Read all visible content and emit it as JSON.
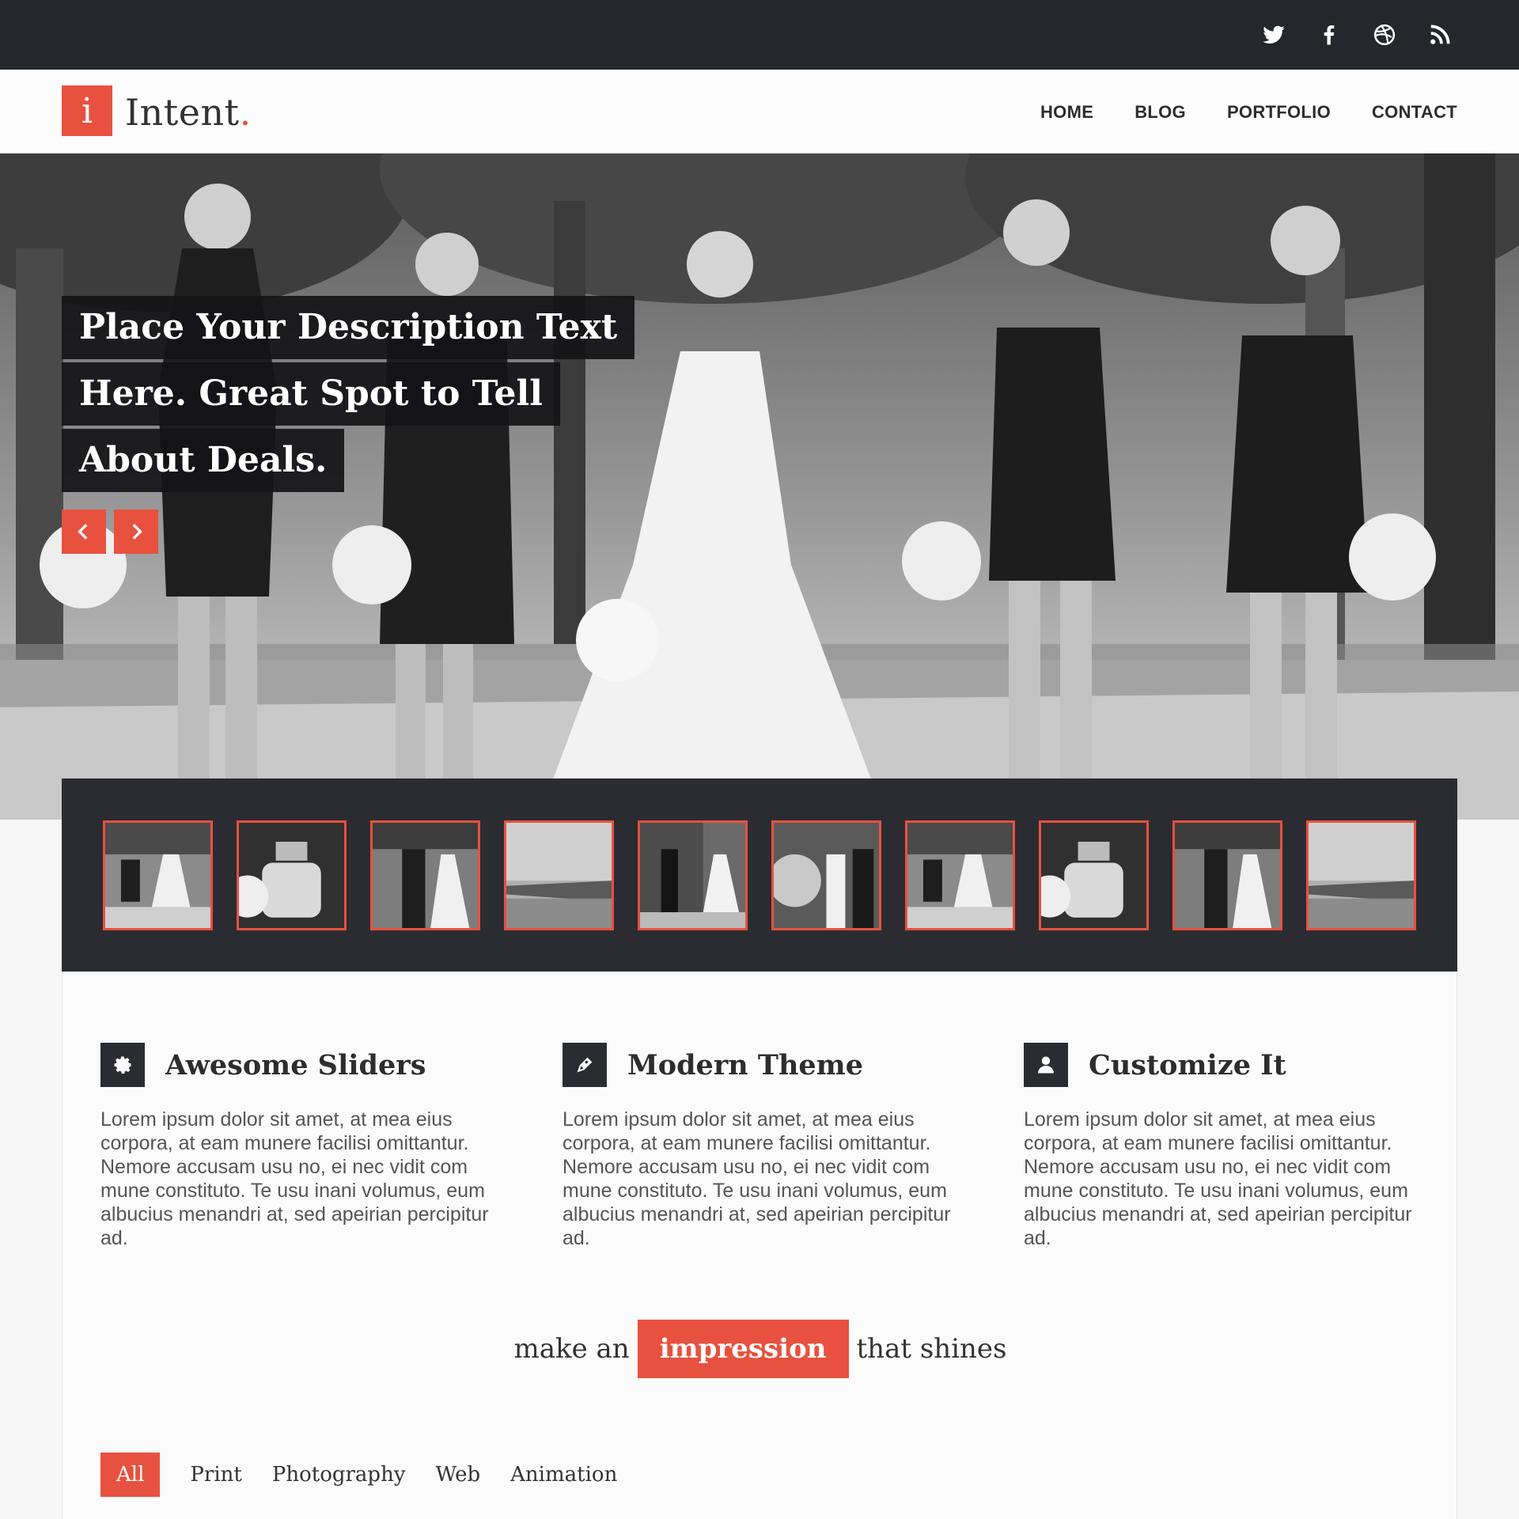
{
  "colors": {
    "accent": "#e8513f",
    "dark": "#24272c",
    "strip": "#2a2c31"
  },
  "social": {
    "icons": [
      "twitter-icon",
      "facebook-icon",
      "dribbble-icon",
      "rss-icon"
    ]
  },
  "header": {
    "logo_letter": "i",
    "logo_text": "Intent",
    "logo_dot": ".",
    "nav": [
      "HOME",
      "BLOG",
      "PORTFOLIO",
      "CONTACT"
    ]
  },
  "hero": {
    "caption_lines": [
      "Place Your Description Text",
      "Here. Great Spot to Tell",
      "About Deals."
    ],
    "prev_icon": "chevron-left-icon",
    "next_icon": "chevron-right-icon"
  },
  "thumbnails": {
    "count": 10,
    "subjects": [
      "bridal-party",
      "perfume-bottle",
      "couple-walking",
      "bridge",
      "couple-wall",
      "group",
      "bridal-party",
      "perfume-bottle",
      "couple-walking",
      "bridge"
    ]
  },
  "features": [
    {
      "icon": "gear-icon",
      "title": "Awesome Sliders",
      "text": "Lorem ipsum dolor sit amet, at mea eius corpora, at eam munere facilisi omittantur. Nemore accusam usu no, ei nec vidit com mune constituto. Te usu inani volumus, eum albucius menandri at, sed apeirian percipitur ad."
    },
    {
      "icon": "pen-icon",
      "title": "Modern Theme",
      "text": "Lorem ipsum dolor sit amet, at mea eius corpora, at eam munere facilisi omittantur. Nemore accusam usu no, ei nec vidit com mune constituto. Te usu inani volumus, eum albucius menandri at, sed apeirian percipitur ad."
    },
    {
      "icon": "user-icon",
      "title": "Customize It",
      "text": "Lorem ipsum dolor sit amet, at mea eius corpora, at eam munere facilisi omittantur. Nemore accusam usu no, ei nec vidit com mune constituto. Te usu inani volumus, eum albucius menandri at, sed apeirian percipitur ad."
    }
  ],
  "tagline": {
    "before": "make an",
    "highlight": "impression",
    "after": "that shines"
  },
  "filters": {
    "items": [
      "All",
      "Print",
      "Photography",
      "Web",
      "Animation"
    ],
    "active": "All"
  }
}
